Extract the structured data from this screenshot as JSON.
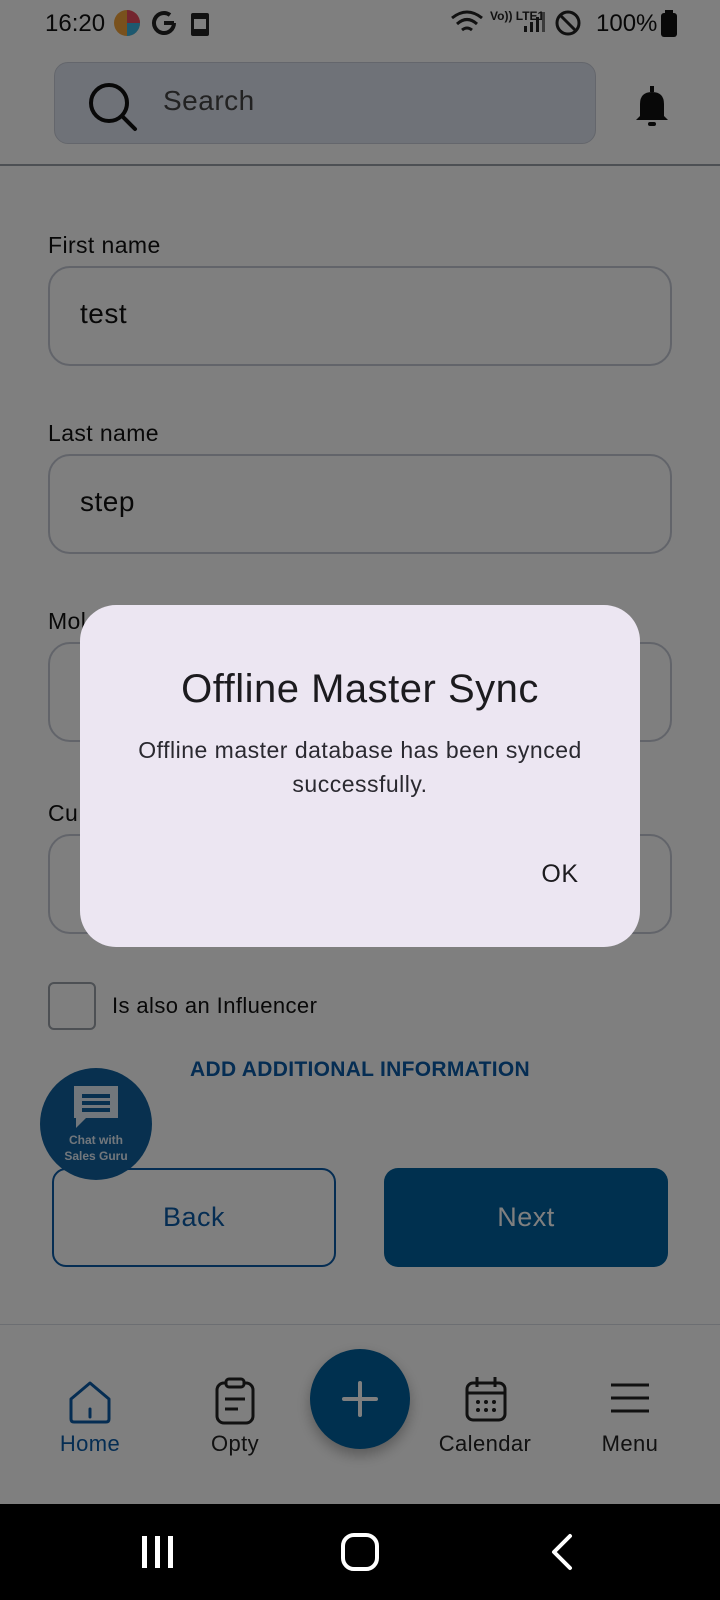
{
  "status_bar": {
    "time": "16:20",
    "battery_percent": "100%",
    "network_label": "Vo)) LTE1"
  },
  "header": {
    "search_placeholder": "Search"
  },
  "form": {
    "first_name": {
      "label": "First name",
      "value": "test"
    },
    "last_name": {
      "label": "Last name",
      "value": "step"
    },
    "mobile": {
      "label_visible": "Mol"
    },
    "customer": {
      "label_visible": "Cu"
    },
    "influencer_checkbox": {
      "label": "Is also an Influencer",
      "checked": false
    },
    "add_info_link": "ADD ADDITIONAL INFORMATION",
    "back_button": "Back",
    "next_button": "Next"
  },
  "chat_fab": {
    "line1": "Chat with",
    "line2": "Sales Guru"
  },
  "bottom_nav": {
    "items": [
      {
        "label": "Home",
        "icon": "home-icon",
        "active": true
      },
      {
        "label": "Opty",
        "icon": "clipboard-icon",
        "active": false
      },
      {
        "label": "Calendar",
        "icon": "calendar-icon",
        "active": false
      },
      {
        "label": "Menu",
        "icon": "menu-icon",
        "active": false
      }
    ],
    "fab_icon": "plus-icon"
  },
  "dialog": {
    "title": "Offline Master Sync",
    "message": "Offline master database has been synced successfully.",
    "ok_label": "OK"
  },
  "colors": {
    "primary": "#00619f",
    "dialog_bg": "#ece6f2",
    "overlay": "rgba(0,0,0,0.5)"
  }
}
